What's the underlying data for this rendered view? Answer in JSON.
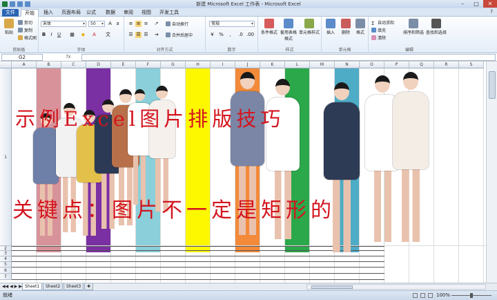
{
  "app": {
    "title": "新建 Microsoft Excel 工作表 - Microsoft Excel",
    "window_controls": [
      "–",
      "□",
      "✕"
    ]
  },
  "ribbon_tabs": [
    "文件",
    "开始",
    "插入",
    "页面布局",
    "公式",
    "数据",
    "审阅",
    "视图",
    "开发工具"
  ],
  "ribbon": {
    "clipboard": {
      "paste": "粘贴",
      "cut": "剪切",
      "copy": "复制",
      "format_painter": "格式刷",
      "label": "剪贴板"
    },
    "font": {
      "name": "宋体",
      "size": "50",
      "label": "字体"
    },
    "alignment": {
      "wrap": "自动换行",
      "merge": "合并后居中",
      "label": "对齐方式"
    },
    "number": {
      "format": "常规",
      "label": "数字"
    },
    "styles": {
      "conditional": "条件格式",
      "table": "套用表格格式",
      "cell_styles": "单元格样式",
      "label": "样式"
    },
    "cells": {
      "insert": "插入",
      "delete": "删除",
      "format": "格式",
      "label": "单元格"
    },
    "editing": {
      "autosum": "自动求和",
      "fill": "填充",
      "clear": "清除",
      "sort": "排序和筛选",
      "find": "查找和选择",
      "label": "编辑"
    }
  },
  "formula_bar": {
    "name_box": "G2",
    "fx": "fx",
    "value": ""
  },
  "grid": {
    "columns": [
      "A",
      "B",
      "C",
      "D",
      "E",
      "F",
      "G",
      "H",
      "I",
      "J",
      "K",
      "L",
      "M",
      "N",
      "O",
      "P",
      "Q",
      "R",
      "S"
    ],
    "rows": [
      "1",
      "2",
      "3",
      "4",
      "5",
      "6",
      "7"
    ]
  },
  "stripes": {
    "colors": [
      "#ffffff",
      "#d8939a",
      "#ffffff",
      "#7a2fa3",
      "#ffffff",
      "#8acfd9",
      "#ffffff",
      "#fdf700",
      "#ffffff",
      "#f28a3a",
      "#ffffff",
      "#2ba84a",
      "#ffffff",
      "#4eacc6",
      "#ffffff"
    ]
  },
  "overlay_text": {
    "line1": "示例Excel图片排版技巧",
    "line2": "关键点：图片不一定是矩形的"
  },
  "sheets": [
    "Sheet1",
    "Sheet2",
    "Sheet3"
  ],
  "status": {
    "left": "就绪",
    "zoom": "100%"
  }
}
